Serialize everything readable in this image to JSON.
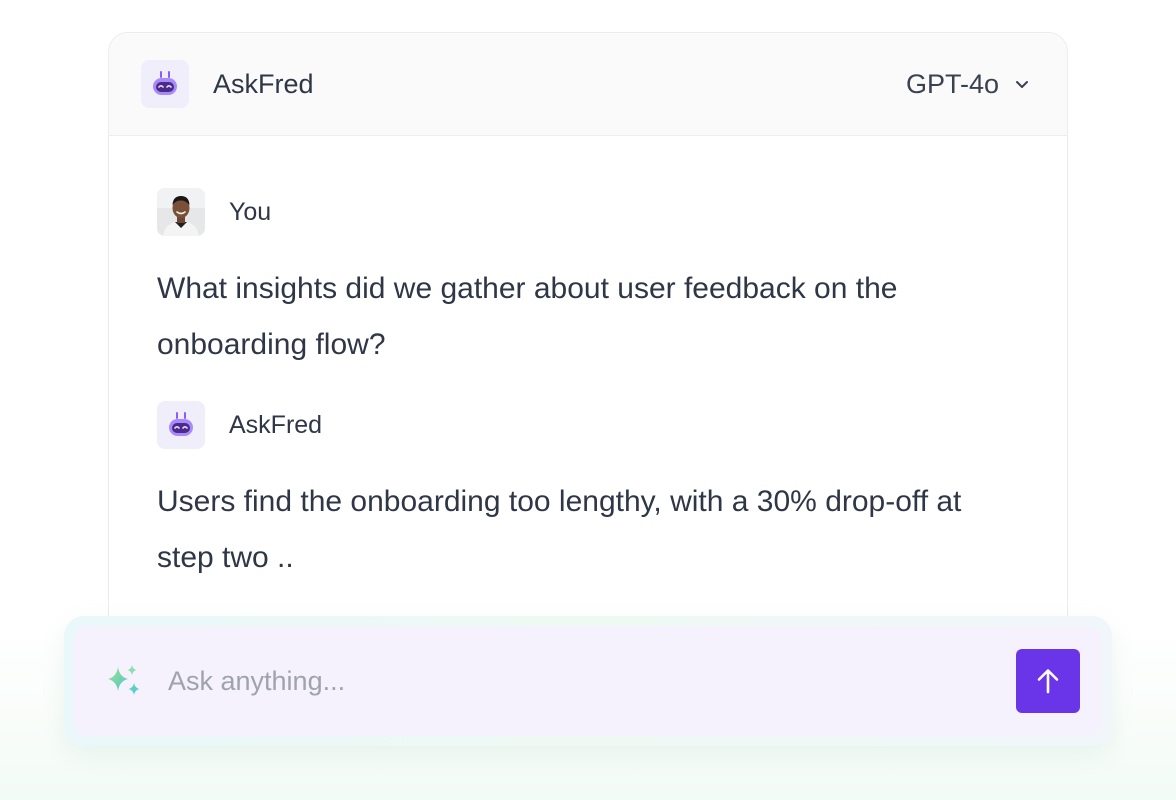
{
  "header": {
    "title": "AskFred",
    "model": "GPT-4o"
  },
  "messages": [
    {
      "author": "You",
      "text": "What insights did we gather about user feedback on the onboarding flow?"
    },
    {
      "author": "AskFred",
      "text": "Users find the onboarding too lengthy, with a 30% drop-off at step two .."
    }
  ],
  "composer": {
    "placeholder": "Ask anything...",
    "value": ""
  },
  "colors": {
    "accent": "#6a35e8",
    "bot_tile": "#f1eefb",
    "composer_bg": "#f5f1fd"
  },
  "icons": {
    "bot": "robot-icon",
    "model_toggle": "chevron-down-icon",
    "composer_left": "sparkle-icon",
    "send": "arrow-up-icon"
  }
}
